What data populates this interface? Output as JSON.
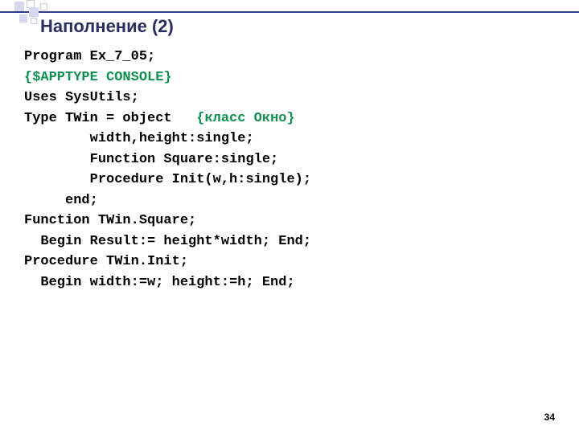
{
  "title": "Наполнение (2)",
  "code": {
    "l1": "Program Ex_7_05;",
    "l2": "{$APPTYPE CONSOLE}",
    "l3": "Uses SysUtils;",
    "l4a": "Type TWin = object   ",
    "l4b": "{класс Окно}",
    "l5": "        width,height:single;",
    "l6": "        Function Square:single;",
    "l7": "        Procedure Init(w,h:single);",
    "l8": "     end;",
    "l9": "Function TWin.Square;",
    "l10": "  Begin Result:= height*width; End;",
    "l11": "Procedure TWin.Init;",
    "l12": "  Begin width:=w; height:=h; End;"
  },
  "page_number": "34"
}
